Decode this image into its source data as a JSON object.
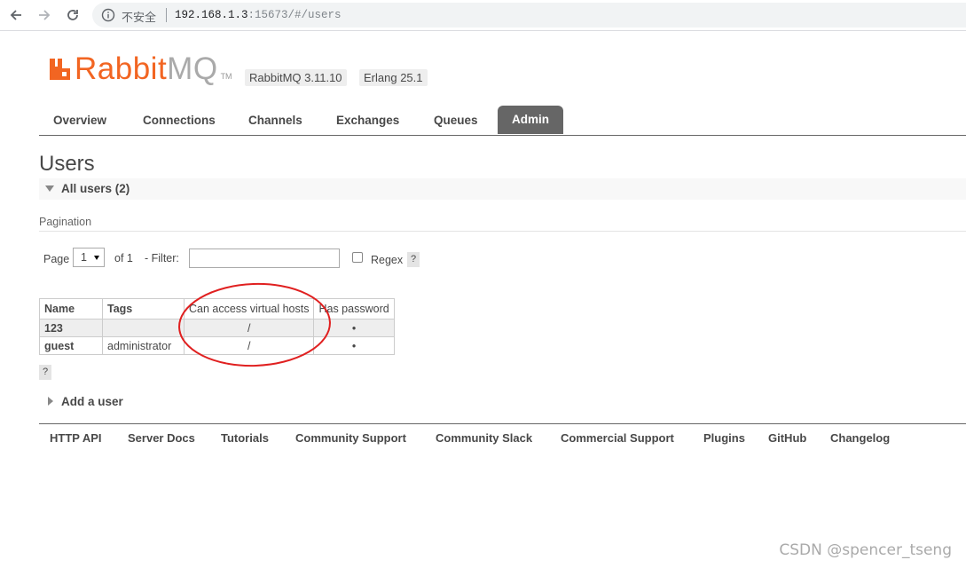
{
  "browser": {
    "security_label": "不安全",
    "url_host": "192.168.1.3",
    "url_rest": ":15673/#/users"
  },
  "header": {
    "logo_rabbit": "Rabbit",
    "logo_mq": "MQ",
    "logo_tm": "TM",
    "version": "RabbitMQ 3.11.10",
    "erlang": "Erlang 25.1"
  },
  "tabs": [
    {
      "label": "Overview"
    },
    {
      "label": "Connections"
    },
    {
      "label": "Channels"
    },
    {
      "label": "Exchanges"
    },
    {
      "label": "Queues"
    },
    {
      "label": "Admin",
      "active": true
    }
  ],
  "page": {
    "title": "Users",
    "section": "All users (2)",
    "pagination_label": "Pagination",
    "page_word": "Page",
    "page_value": "1",
    "of_text": "of 1",
    "filter_label": "- Filter:",
    "filter_value": "",
    "regex_label": "Regex",
    "help": "?"
  },
  "table": {
    "headers": [
      "Name",
      "Tags",
      "Can access virtual hosts",
      "Has password"
    ],
    "rows": [
      {
        "name": "123",
        "tags": "",
        "vhosts": "/",
        "has_password": "•"
      },
      {
        "name": "guest",
        "tags": "administrator",
        "vhosts": "/",
        "has_password": "•"
      }
    ]
  },
  "add_user": "Add a user",
  "footer": [
    {
      "label": "HTTP API"
    },
    {
      "label": "Server Docs"
    },
    {
      "label": "Tutorials"
    },
    {
      "label": "Community Support"
    },
    {
      "label": "Community Slack"
    },
    {
      "label": "Commercial Support"
    },
    {
      "label": "Plugins"
    },
    {
      "label": "GitHub"
    },
    {
      "label": "Changelog"
    }
  ],
  "watermark": "CSDN @spencer_tseng",
  "colors": {
    "brand_orange": "#f26522",
    "tab_active_bg": "#666666",
    "annotation_red": "#e02020"
  }
}
